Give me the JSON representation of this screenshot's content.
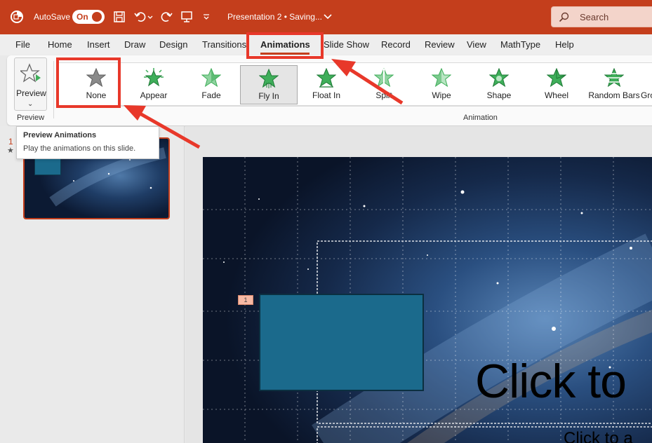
{
  "titlebar": {
    "autosave_label": "AutoSave",
    "toggle_label": "On",
    "document_title": "Presentation 2 • Saving...",
    "search_placeholder": "Search"
  },
  "tabs": [
    {
      "label": "File"
    },
    {
      "label": "Home"
    },
    {
      "label": "Insert"
    },
    {
      "label": "Draw"
    },
    {
      "label": "Design"
    },
    {
      "label": "Transitions"
    },
    {
      "label": "Animations"
    },
    {
      "label": "Slide Show"
    },
    {
      "label": "Record"
    },
    {
      "label": "Review"
    },
    {
      "label": "View"
    },
    {
      "label": "MathType"
    },
    {
      "label": "Help"
    }
  ],
  "active_tab": "Animations",
  "ribbon": {
    "preview_button_label": "Preview",
    "preview_group_label": "Preview",
    "animation_group_label": "Animation",
    "animations": [
      {
        "label": "None",
        "icon": "star-gray-icon"
      },
      {
        "label": "Appear",
        "icon": "star-burst-icon"
      },
      {
        "label": "Fade",
        "icon": "star-fade-icon"
      },
      {
        "label": "Fly In",
        "icon": "star-flyin-icon",
        "selected": true
      },
      {
        "label": "Float In",
        "icon": "star-floatin-icon"
      },
      {
        "label": "Split",
        "icon": "star-split-icon"
      },
      {
        "label": "Wipe",
        "icon": "star-wipe-icon"
      },
      {
        "label": "Shape",
        "icon": "star-shape-icon"
      },
      {
        "label": "Wheel",
        "icon": "star-wheel-icon"
      },
      {
        "label": "Random Bars",
        "icon": "star-bars-icon"
      },
      {
        "label": "Gro",
        "icon": "star-grow-icon"
      }
    ]
  },
  "tooltip": {
    "title": "Preview Animations",
    "description": "Play the animations on this slide."
  },
  "slide_pane": {
    "slide_number": "1",
    "animation_marker": "★"
  },
  "slide": {
    "animation_tag": "1",
    "title_placeholder": "Click to",
    "subtitle_placeholder": "Click to a"
  },
  "colors": {
    "accent": "#c43e1c",
    "annotation": "#e8382a",
    "shape_fill": "#1b6a8c",
    "star_green": "#3fae5a"
  }
}
